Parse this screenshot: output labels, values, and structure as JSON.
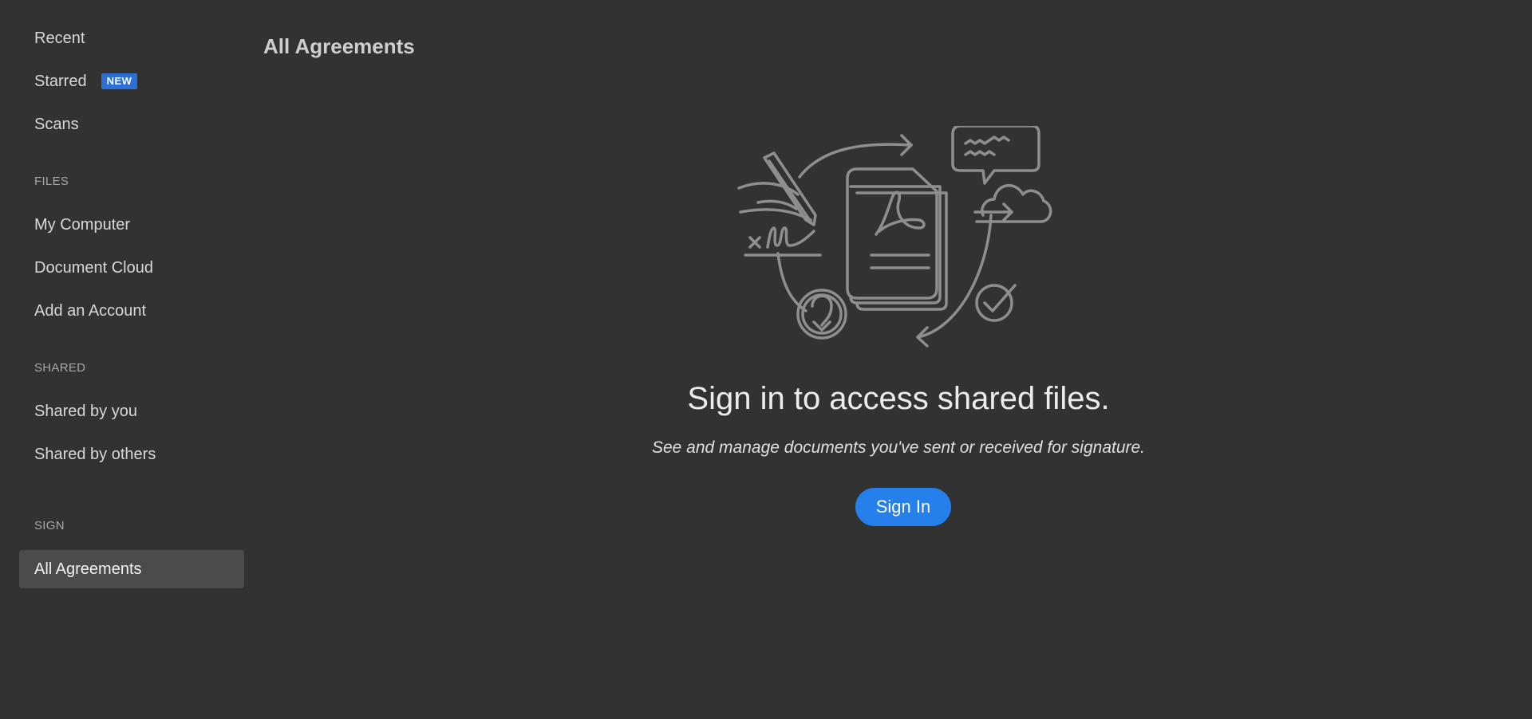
{
  "sidebar": {
    "items_top": [
      {
        "label": "Recent"
      },
      {
        "label": "Starred",
        "badge": "NEW"
      },
      {
        "label": "Scans"
      }
    ],
    "files": {
      "header": "FILES",
      "items": [
        {
          "label": "My Computer"
        },
        {
          "label": "Document Cloud"
        },
        {
          "label": "Add an Account"
        }
      ]
    },
    "shared": {
      "header": "SHARED",
      "items": [
        {
          "label": "Shared by you"
        },
        {
          "label": "Shared by others"
        }
      ]
    },
    "sign": {
      "header": "SIGN",
      "items": [
        {
          "label": "All Agreements",
          "selected": true
        }
      ]
    }
  },
  "main": {
    "title": "All Agreements",
    "empty_state": {
      "illustration_icon": "agreements-illustration-icon",
      "heading": "Sign in to access shared files.",
      "subheading": "See and manage documents you've sent or received for signature.",
      "button_label": "Sign In"
    }
  },
  "colors": {
    "background": "#323232",
    "selected_item": "#4b4b4b",
    "badge": "#2c6fd6",
    "primary_button": "#2680eb",
    "illustration_stroke": "#8e8e8e"
  }
}
